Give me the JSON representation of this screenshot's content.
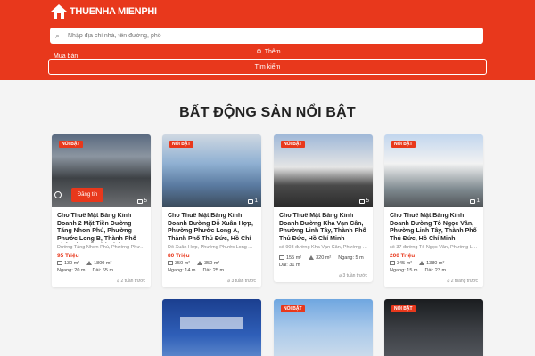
{
  "header": {
    "logo_text": "THUENHA MIENPHI",
    "search_placeholder": "Nhập địa chỉ nhà, tên đường, phố",
    "more_label": "Thêm",
    "mua_ban": "Mua bán",
    "search_button": "Tìm kiếm",
    "bg_color": "#e8381c"
  },
  "section_title": "BẤT ĐỘNG SẢN NỔI BẬT",
  "badge_label": "NỔI BẬT",
  "listings": [
    {
      "title": "Cho Thuê Mặt Bằng Kinh Doanh 2 Mặt Tiền Đường Tăng Nhơn Phú, Phường Phước Long B, Thành Phố Thủ Đức, Hồ Chí Minh.",
      "address": "Đường Tăng Nhơn Phú, Phường Phước...",
      "price": "95 Triệu",
      "area_land": "130 m²",
      "area_use": "1800 m²",
      "width": "Ngang: 20 m",
      "depth": "Dài: 65 m",
      "posted": "2 tuần trước",
      "image_count": "5",
      "post_button": "Đăng tin"
    },
    {
      "title": "Cho Thuê Mặt Bằng Kinh Doanh Đường Đỗ Xuân Hợp, Phường Phước Long A, Thành Phố Thủ Đức, Hồ Chí Minh.",
      "address": "Đỗ Xuân Hợp, Phường Phước Long A,...",
      "price": "80 Triệu",
      "area_land": "350 m²",
      "area_use": "350 m²",
      "width": "Ngang: 14 m",
      "depth": "Dài: 25 m",
      "posted": "3 tuần trước",
      "image_count": "1"
    },
    {
      "title": "Cho Thuê Mặt Bằng Kinh Doanh Đường Kha Vạn Cân, Phường Linh Tây, Thành Phố Thủ Đức, Hồ Chí Minh",
      "address": "số 903 đường Kha Vạn Cân, Phường Li...",
      "price": "",
      "area_land": "155 m²",
      "area_use": "320 m²",
      "width": "Dài: 31 m",
      "depth": "Ngang: 5 m",
      "posted": "3 tuần trước",
      "image_count": "5"
    },
    {
      "title": "Cho Thuê Mặt Bằng Kinh Doanh Đường Tô Ngọc Vân, Phường Linh Tây, Thành Phố Thủ Đức, Hồ Chí Minh",
      "address": "số 37 đường Tô Ngọc Vân, Phường Lin...",
      "price": "200 Triệu",
      "area_land": "345 m²",
      "area_use": "1380 m²",
      "width": "Ngang: 15 m",
      "depth": "Dài: 23 m",
      "posted": "2 tháng trước",
      "image_count": "1"
    }
  ]
}
